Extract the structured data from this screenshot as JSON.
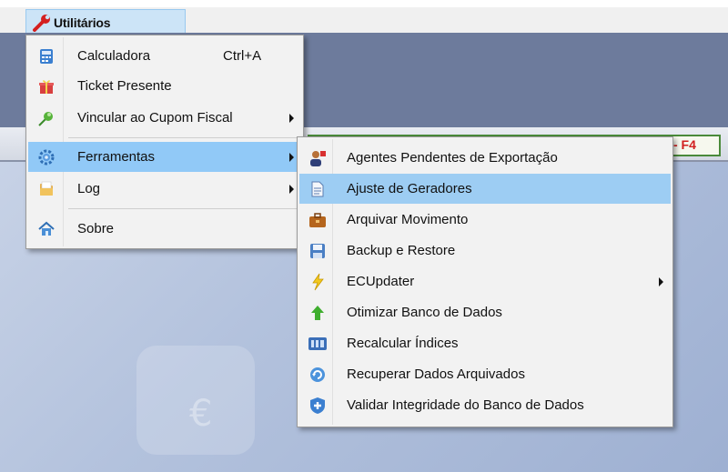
{
  "menubar": {
    "label": "Utilitários"
  },
  "toolbar": {
    "shortcut_hint": "- F4"
  },
  "workspace": {
    "watermark_symbol": "€"
  },
  "menu_main": {
    "items": [
      {
        "label": "Calculadora",
        "shortcut": "Ctrl+A",
        "icon": "calculator-icon"
      },
      {
        "label": "Ticket Presente",
        "icon": "gift-icon"
      },
      {
        "label": "Vincular ao Cupom Fiscal",
        "icon": "pin-icon",
        "submenu": true
      },
      {
        "label": "Ferramentas",
        "icon": "gear-icon",
        "submenu": true,
        "selected": true
      },
      {
        "label": "Log",
        "icon": "folder-icon",
        "submenu": true
      },
      {
        "label": "Sobre",
        "icon": "home-icon"
      }
    ]
  },
  "menu_tools": {
    "items": [
      {
        "label": "Agentes Pendentes de Exportação",
        "icon": "agents-icon"
      },
      {
        "label": "Ajuste de Geradores",
        "icon": "document-icon",
        "selected": true
      },
      {
        "label": "Arquivar Movimento",
        "icon": "briefcase-icon"
      },
      {
        "label": "Backup e Restore",
        "icon": "floppy-icon"
      },
      {
        "label": "ECUpdater",
        "icon": "lightning-icon",
        "submenu": true
      },
      {
        "label": "Otimizar Banco de Dados",
        "icon": "up-arrow-icon"
      },
      {
        "label": "Recalcular Índices",
        "icon": "index-icon"
      },
      {
        "label": "Recuperar Dados Arquivados",
        "icon": "recover-icon"
      },
      {
        "label": "Validar Integridade do Banco de Dados",
        "icon": "shield-icon"
      }
    ]
  },
  "colors": {
    "highlight": "#91c9f7",
    "menubar_highlight": "#cce4f7",
    "app_header": "#6d7b9c"
  }
}
